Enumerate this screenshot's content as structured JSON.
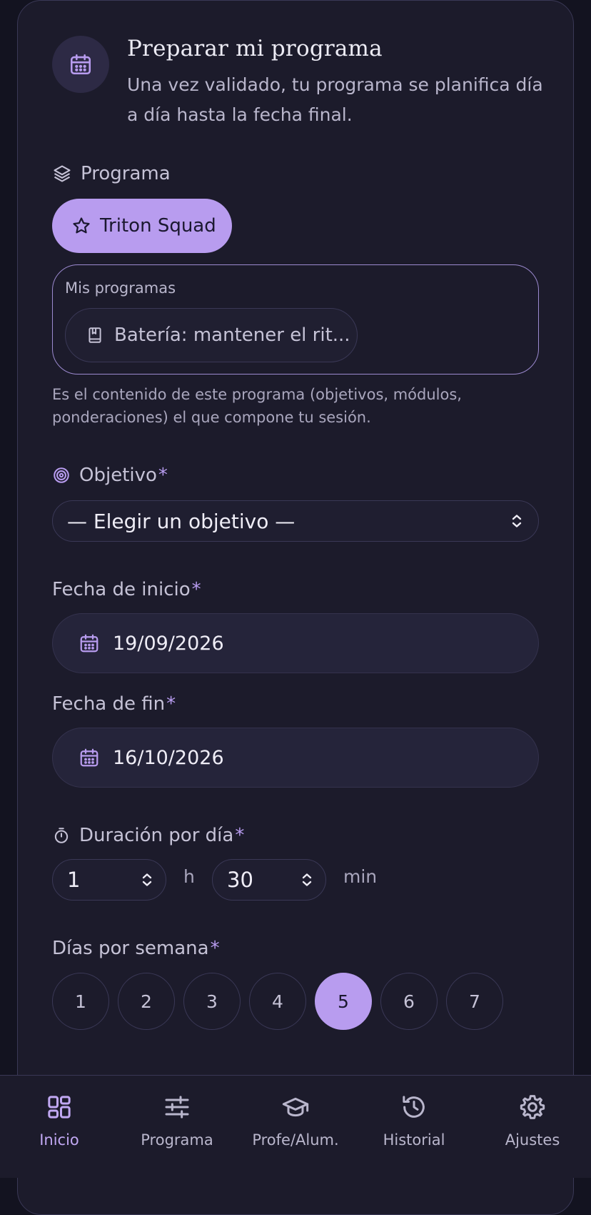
{
  "header": {
    "icon": "calendar-icon",
    "title": "Preparar mi programa",
    "subtitle": "Una vez validado, tu programa se planifica día a día hasta la fecha final."
  },
  "programa": {
    "label": "Programa",
    "icon": "layers-icon",
    "selected_chip": {
      "label": "Triton Squad",
      "icon": "star-icon"
    },
    "mis_programas": {
      "label": "Mis programas",
      "items": [
        {
          "label": "Batería: mantener el rit...",
          "icon": "bookmark-book-icon"
        }
      ]
    },
    "help": "Es el contenido de este programa (objetivos, módulos, ponderaciones) el que compone tu sesión."
  },
  "objetivo": {
    "label": "Objetivo",
    "required": "*",
    "icon": "target-icon",
    "value": "— Elegir un objetivo —"
  },
  "fecha_inicio": {
    "label": "Fecha de inicio",
    "required": "*",
    "value": "19/09/2026"
  },
  "fecha_fin": {
    "label": "Fecha de fin",
    "required": "*",
    "value": "16/10/2026"
  },
  "duracion": {
    "label": "Duración por día",
    "required": "*",
    "icon": "stopwatch-icon",
    "hours": "1",
    "hours_unit": "h",
    "minutes": "30",
    "minutes_unit": "min"
  },
  "dias_semana": {
    "label": "Días por semana",
    "required": "*",
    "options": [
      "1",
      "2",
      "3",
      "4",
      "5",
      "6",
      "7"
    ],
    "selected": "5"
  },
  "nav": {
    "items": [
      {
        "label": "Inicio",
        "icon": "grid-icon",
        "active": true
      },
      {
        "label": "Programa",
        "icon": "sliders-icon",
        "active": false
      },
      {
        "label": "Profe/Alum.",
        "icon": "graduation-cap-icon",
        "active": false
      },
      {
        "label": "Historial",
        "icon": "history-icon",
        "active": false
      },
      {
        "label": "Ajustes",
        "icon": "gear-icon",
        "active": false
      }
    ]
  },
  "colors": {
    "accent": "#b89cef",
    "background": "#131320",
    "card": "#1c1b2b",
    "border": "#3a3856"
  }
}
